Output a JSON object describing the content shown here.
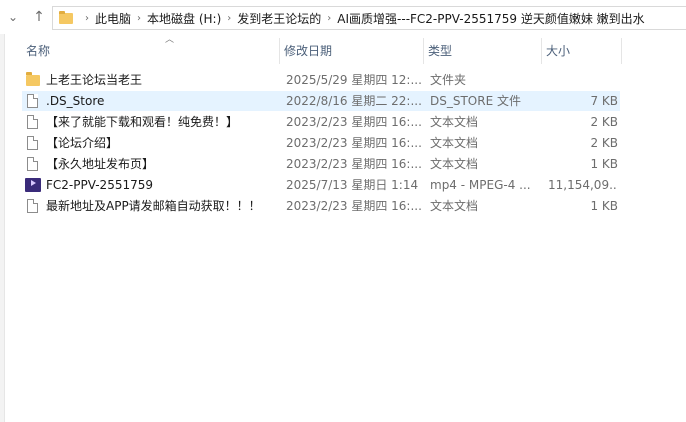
{
  "addressbar": {
    "crumbs": [
      "此电脑",
      "本地磁盘 (H:)",
      "发到老王论坛的",
      "AI画质增强---FC2-PPV-2551759 逆天颜值嫩妹 嫩到出水"
    ]
  },
  "columns": {
    "name": "名称",
    "date": "修改日期",
    "type": "类型",
    "size": "大小"
  },
  "files": [
    {
      "name": "上老王论坛当老王",
      "date": "2025/5/29 星期四 12:...",
      "type": "文件夹",
      "size": "",
      "icon": "folder-icon"
    },
    {
      "name": ".DS_Store",
      "date": "2022/8/16 星期二 22:...",
      "type": "DS_STORE 文件",
      "size": "7 KB",
      "icon": "file-icon"
    },
    {
      "name": "【来了就能下载和观看！纯免费！】",
      "date": "2023/2/23 星期四 16:...",
      "type": "文本文档",
      "size": "2 KB",
      "icon": "text-file-icon"
    },
    {
      "name": "【论坛介绍】",
      "date": "2023/2/23 星期四 16:...",
      "type": "文本文档",
      "size": "2 KB",
      "icon": "text-file-icon"
    },
    {
      "name": "【永久地址发布页】",
      "date": "2023/2/23 星期四 16:...",
      "type": "文本文档",
      "size": "1 KB",
      "icon": "text-file-icon"
    },
    {
      "name": "FC2-PPV-2551759",
      "date": "2025/7/13 星期日 1:14",
      "type": "mp4 - MPEG-4 ...",
      "size": "11,154,09...",
      "icon": "video-file-icon"
    },
    {
      "name": "最新地址及APP请发邮箱自动获取！！！",
      "date": "2023/2/23 星期四 16:...",
      "type": "文本文档",
      "size": "1 KB",
      "icon": "text-file-icon"
    }
  ]
}
